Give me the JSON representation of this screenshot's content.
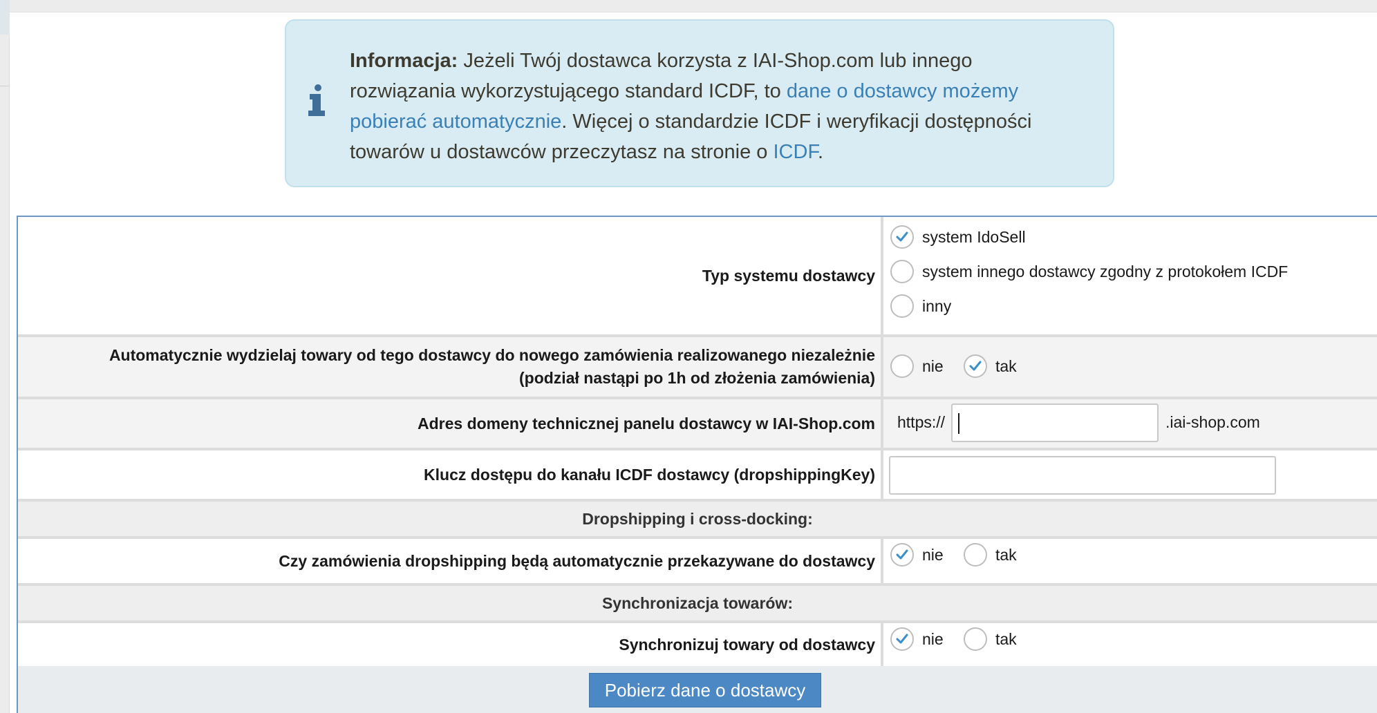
{
  "info": {
    "bold_label": "Informacja:",
    "text_1": " Jeżeli Twój dostawca korzysta z IAI-Shop.com lub innego rozwiązania wykorzystującego standard ICDF, to ",
    "link_1": "dane o dostawcy możemy pobierać automatycznie",
    "text_2": ". Więcej o standardzie ICDF i weryfikacji dostępności towarów u dostawców przeczytasz na stronie o ",
    "link_2": "ICDF",
    "text_3": "."
  },
  "form": {
    "system_type": {
      "label": "Typ systemu dostawcy",
      "options": [
        {
          "label": "system IdoSell",
          "checked": true
        },
        {
          "label": "system innego dostawcy zgodny z protokołem ICDF",
          "checked": false
        },
        {
          "label": "inny",
          "checked": false
        }
      ]
    },
    "auto_split": {
      "label_line1": "Automatycznie wydzielaj towary od tego dostawcy do nowego zamówienia realizowanego niezależnie",
      "label_line2": "(podział nastąpi po 1h od złożenia zamówienia)",
      "options": [
        {
          "label": "nie",
          "checked": false
        },
        {
          "label": "tak",
          "checked": true
        }
      ]
    },
    "domain": {
      "label": "Adres domeny technicznej panelu dostawcy w IAI-Shop.com",
      "prefix": "https://",
      "value": "",
      "suffix": ".iai-shop.com"
    },
    "icdf_key": {
      "label": "Klucz dostępu do kanału ICDF dostawcy (dropshippingKey)",
      "value": ""
    },
    "section_dropshipping": "Dropshipping i cross-docking:",
    "dropship_forward": {
      "label": "Czy zamówienia dropshipping będą automatycznie przekazywane do dostawcy",
      "options": [
        {
          "label": "nie",
          "checked": true
        },
        {
          "label": "tak",
          "checked": false
        }
      ]
    },
    "section_sync": "Synchronizacja towarów:",
    "sync_products": {
      "label": "Synchronizuj towary od dostawcy",
      "options": [
        {
          "label": "nie",
          "checked": true
        },
        {
          "label": "tak",
          "checked": false
        }
      ]
    },
    "fetch_button": "Pobierz dane o dostawcy"
  },
  "colors": {
    "accent": "#4b88c4",
    "info_bg": "#d9ecf4",
    "link": "#3a80b5",
    "annotation_arrow": "#e5452b"
  }
}
